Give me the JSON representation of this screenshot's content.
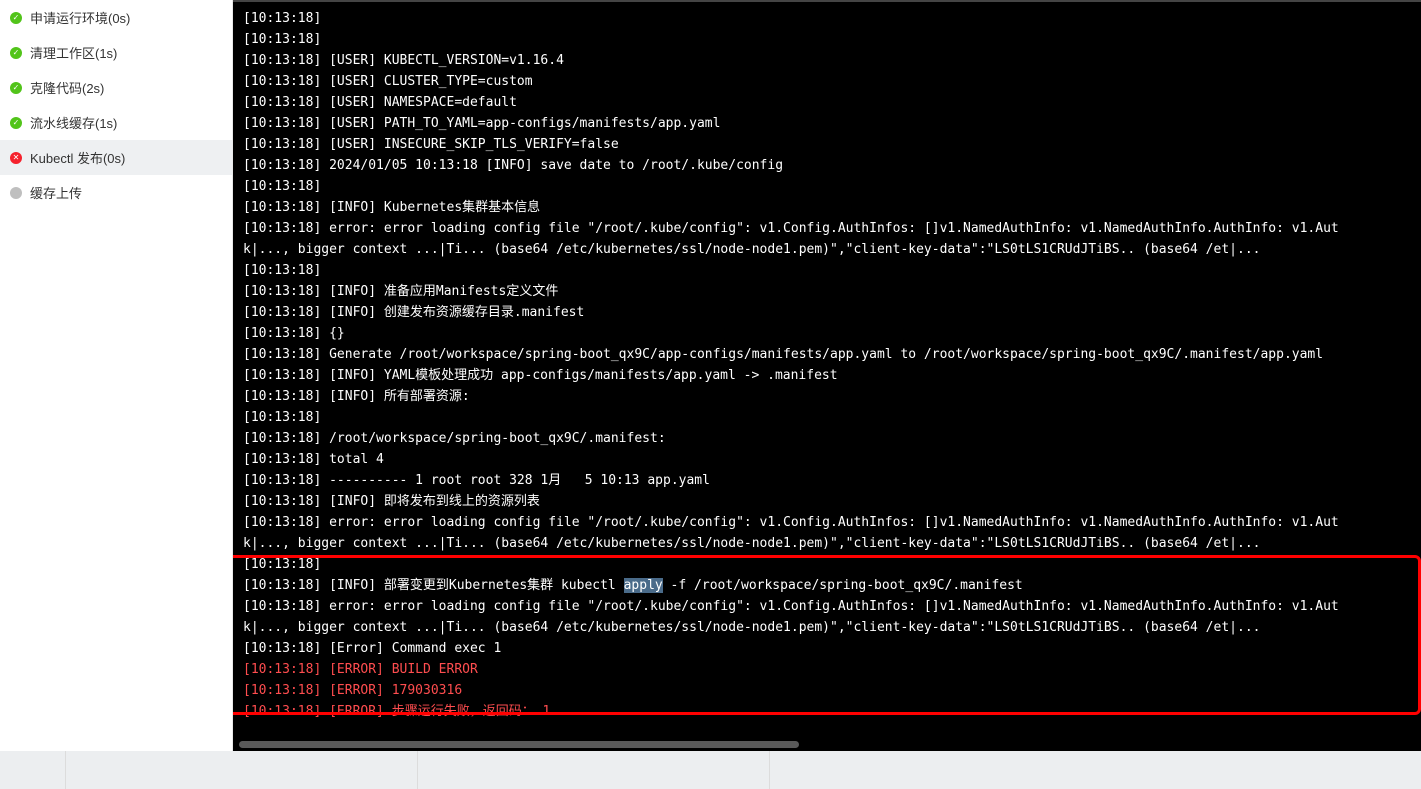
{
  "sidebar": {
    "steps": [
      {
        "status": "success",
        "label": "申请运行环境(0s)"
      },
      {
        "status": "success",
        "label": "清理工作区(1s)"
      },
      {
        "status": "success",
        "label": "克隆代码(2s)"
      },
      {
        "status": "success",
        "label": "流水线缓存(1s)"
      },
      {
        "status": "error",
        "label": "Kubectl 发布(0s)",
        "active": true
      },
      {
        "status": "pending",
        "label": "缓存上传"
      }
    ]
  },
  "console": {
    "lines": [
      {
        "t": "[10:13:18]"
      },
      {
        "t": "[10:13:18]"
      },
      {
        "t": "[10:13:18] [USER] KUBECTL_VERSION=v1.16.4"
      },
      {
        "t": "[10:13:18] [USER] CLUSTER_TYPE=custom"
      },
      {
        "t": "[10:13:18] [USER] NAMESPACE=default"
      },
      {
        "t": "[10:13:18] [USER] PATH_TO_YAML=app-configs/manifests/app.yaml"
      },
      {
        "t": "[10:13:18] [USER] INSECURE_SKIP_TLS_VERIFY=false"
      },
      {
        "t": "[10:13:18] 2024/01/05 10:13:18 [INFO] save date to /root/.kube/config"
      },
      {
        "t": "[10:13:18]"
      },
      {
        "t": "[10:13:18] [INFO] Kubernetes集群基本信息"
      },
      {
        "t": "[10:13:18] error: error loading config file \"/root/.kube/config\": v1.Config.AuthInfos: []v1.NamedAuthInfo: v1.NamedAuthInfo.AuthInfo: v1.Aut"
      },
      {
        "t": "k|..., bigger context ...|Ti... (base64 /etc/kubernetes/ssl/node-node1.pem)\",\"client-key-data\":\"LS0tLS1CRUdJTiBS.. (base64 /et|..."
      },
      {
        "t": "[10:13:18]"
      },
      {
        "t": "[10:13:18] [INFO] 准备应用Manifests定义文件"
      },
      {
        "t": "[10:13:18] [INFO] 创建发布资源缓存目录.manifest"
      },
      {
        "t": "[10:13:18] {}"
      },
      {
        "t": "[10:13:18] Generate /root/workspace/spring-boot_qx9C/app-configs/manifests/app.yaml to /root/workspace/spring-boot_qx9C/.manifest/app.yaml"
      },
      {
        "t": "[10:13:18] [INFO] YAML模板处理成功 app-configs/manifests/app.yaml -> .manifest"
      },
      {
        "t": "[10:13:18] [INFO] 所有部署资源:"
      },
      {
        "t": "[10:13:18]"
      },
      {
        "t": "[10:13:18] /root/workspace/spring-boot_qx9C/.manifest:"
      },
      {
        "t": "[10:13:18] total 4"
      },
      {
        "t": "[10:13:18] ---------- 1 root root 328 1月   5 10:13 app.yaml"
      },
      {
        "t": "[10:13:18] [INFO] 即将发布到线上的资源列表"
      },
      {
        "t": "[10:13:18] error: error loading config file \"/root/.kube/config\": v1.Config.AuthInfos: []v1.NamedAuthInfo: v1.NamedAuthInfo.AuthInfo: v1.Aut"
      },
      {
        "t": "k|..., bigger context ...|Ti... (base64 /etc/kubernetes/ssl/node-node1.pem)\",\"client-key-data\":\"LS0tLS1CRUdJTiBS.. (base64 /et|..."
      },
      {
        "t": "[10:13:18]"
      },
      {
        "pre": "[10:13:18] [INFO] 部署变更到Kubernetes集群 kubectl ",
        "hl": "apply",
        "post": " -f /root/workspace/spring-boot_qx9C/.manifest"
      },
      {
        "t": "[10:13:18] error: error loading config file \"/root/.kube/config\": v1.Config.AuthInfos: []v1.NamedAuthInfo: v1.NamedAuthInfo.AuthInfo: v1.Aut"
      },
      {
        "t": "k|..., bigger context ...|Ti... (base64 /etc/kubernetes/ssl/node-node1.pem)\",\"client-key-data\":\"LS0tLS1CRUdJTiBS.. (base64 /et|..."
      },
      {
        "t": "[10:13:18] [Error] Command exec 1"
      },
      {
        "t": "[10:13:18] [ERROR] BUILD ERROR",
        "err": true
      },
      {
        "t": "[10:13:18] [ERROR] 179030316",
        "err": true
      },
      {
        "t": "[10:13:18] [ERROR] 步骤运行失败，返回码： 1",
        "err": true
      }
    ]
  },
  "icons": {
    "success_glyph": "✓",
    "error_glyph": "✕",
    "pending_glyph": "●"
  }
}
